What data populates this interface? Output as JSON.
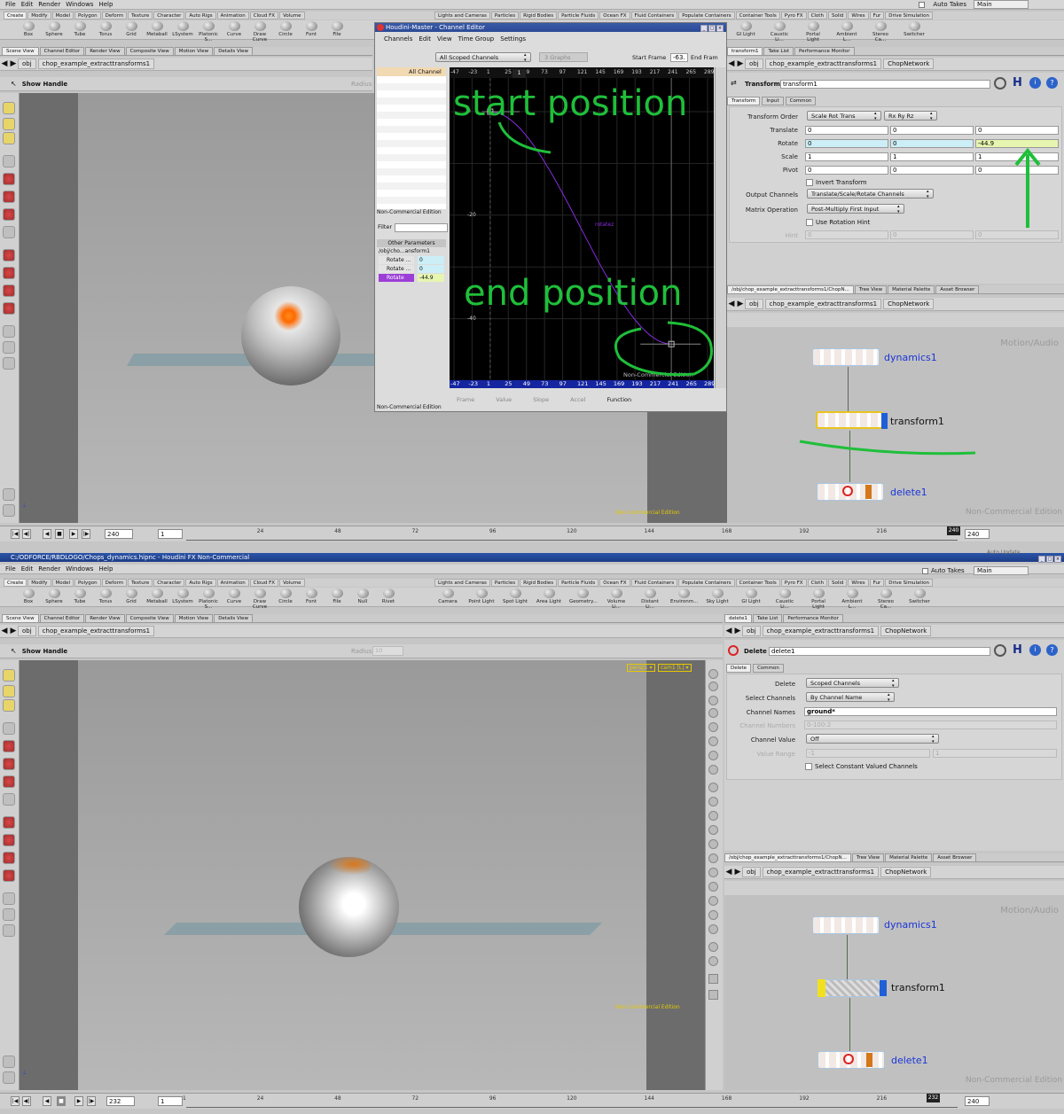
{
  "menu": [
    "File",
    "Edit",
    "Render",
    "Windows",
    "Help"
  ],
  "auto_takes": "Auto Takes",
  "takes_main": "Main",
  "shelf_tabs_left": [
    "Create",
    "Modify",
    "Model",
    "Polygon",
    "Deform",
    "Texture",
    "Character",
    "Auto Rigs",
    "Animation",
    "Cloud FX",
    "Volume"
  ],
  "shelf_tabs_right": [
    "Lights and Cameras",
    "Particles",
    "Rigid Bodies",
    "Particle Fluids",
    "Ocean FX",
    "Fluid Containers",
    "Populate Containers",
    "Container Tools",
    "Pyro FX",
    "Cloth",
    "Solid",
    "Wires",
    "Fur",
    "Drive Simulation"
  ],
  "tools_left_top": [
    "Box",
    "Sphere",
    "Tube",
    "Torus",
    "Grid",
    "Metaball",
    "LSystem",
    "Platonic S...",
    "Curve",
    "Draw Curve",
    "Circle",
    "Font",
    "File"
  ],
  "tools_left_bot": [
    "Box",
    "Sphere",
    "Tube",
    "Torus",
    "Grid",
    "Metaball",
    "LSystem",
    "Platonic S...",
    "Curve",
    "Draw Curve",
    "Circle",
    "Font",
    "File",
    "Null",
    "Rivet"
  ],
  "tools_right_top": [
    "GI Light",
    "Caustic Li...",
    "Portal Light",
    "Ambient L...",
    "Stereo Ca...",
    "Switcher"
  ],
  "tools_right_bot": [
    "Camera",
    "Point Light",
    "Spot Light",
    "Area Light",
    "Geometry...",
    "Volume Li...",
    "Distant Li...",
    "Environm...",
    "Sky Light",
    "GI Light",
    "Caustic Li...",
    "Portal Light",
    "Ambient L...",
    "Stereo Ca...",
    "Switcher"
  ],
  "pane_tabs_left": [
    "Scene View",
    "Channel Editor",
    "Render View",
    "Composite View",
    "Motion View",
    "Details View"
  ],
  "path": {
    "obj": "obj",
    "node": "chop_example_extracttransforms1",
    "net": "ChopNetwork"
  },
  "viewport": {
    "show_handle": "Show Handle",
    "radius": "Radius",
    "radius_val": "10",
    "persp": "persp1 ▾",
    "cam": "cam1 [L] ▾",
    "nce": "Non-Commercial Edition"
  },
  "channel_editor": {
    "title": "Houdini-Master - Channel Editor",
    "menu": [
      "Channels",
      "Edit",
      "View",
      "Time Group",
      "Settings"
    ],
    "scoped": "All Scoped Channels",
    "graphs": "3 Graphs",
    "start_frame_label": "Start Frame",
    "start_frame": "-63.",
    "end_frame_label": "End Fram",
    "tree_item": "All Channel",
    "nce": "Non-Commercial Edition",
    "filter": "Filter",
    "other_params": "Other Parameters",
    "param_path": "/obj/cho...ansform1",
    "params": [
      {
        "name": "Rotate ...",
        "val": "0"
      },
      {
        "name": "Rotate ...",
        "val": "0"
      },
      {
        "name": "Rotate",
        "val": "-44.9"
      }
    ],
    "top_ticks": [
      "-47",
      "-23",
      "1",
      "25",
      "49",
      "73",
      "97",
      "121",
      "145",
      "169",
      "193",
      "217",
      "241",
      "265",
      "289"
    ],
    "bottom_ticks": [
      "-47",
      "-23",
      "1",
      "25",
      "49",
      "73",
      "97",
      "121",
      "145",
      "169",
      "193",
      "217",
      "241",
      "265",
      "289"
    ],
    "y_labels": [
      "0",
      "-20",
      "-40"
    ],
    "curve_label": "rotatez",
    "cur_frame": "1",
    "bottom_fields": [
      "Frame",
      "Value",
      "Slope",
      "Accel",
      "Function"
    ]
  },
  "annotations": {
    "start": "start position",
    "end": "end position"
  },
  "transform_params": {
    "tabs": [
      "Transform",
      "Input",
      "Common"
    ],
    "op_type": "Transform",
    "op_name": "transform1",
    "pane_tabs": [
      "transform1",
      "Take List",
      "Performance Monitor"
    ],
    "transform_order_label": "Transform Order",
    "transform_order": "Scale Rot Trans",
    "rot_order": "Rx Ry Rz",
    "translate_label": "Translate",
    "translate": [
      "0",
      "0",
      "0"
    ],
    "rotate_label": "Rotate",
    "rotate": [
      "0",
      "0",
      "-44.9"
    ],
    "scale_label": "Scale",
    "scale": [
      "1",
      "1",
      "1"
    ],
    "pivot_label": "Pivot",
    "pivot": [
      "0",
      "0",
      "0"
    ],
    "invert": "Invert Transform",
    "output_channels_label": "Output Channels",
    "output_channels": "Translate/Scale/Rotate Channels",
    "matrix_op_label": "Matrix Operation",
    "matrix_op": "Post-Multiply First Input",
    "use_hint": "Use Rotation Hint",
    "hint_label": "Hint",
    "hint": [
      "0",
      "0",
      "0"
    ]
  },
  "delete_params": {
    "tabs": [
      "Delete",
      "Common"
    ],
    "op_type": "Delete",
    "op_name": "delete1",
    "pane_tabs": [
      "delete1",
      "Take List",
      "Performance Monitor"
    ],
    "delete_label": "Delete",
    "delete": "Scoped Channels",
    "select_label": "Select Channels",
    "select": "By Channel Name",
    "names_label": "Channel Names",
    "names": "ground*",
    "numbers_label": "Channel Numbers",
    "numbers": "0-100:2",
    "value_label": "Channel Value",
    "value": "Off",
    "range_label": "Value Range",
    "range": [
      "-1",
      "1"
    ],
    "select_const": "Select Constant Valued Channels"
  },
  "network": {
    "tabs": [
      "/obj/chop_example_extracttransforms1/ChopN...",
      "Tree View",
      "Material Palette",
      "Asset Browser"
    ],
    "motion_audio": "Motion/Audio",
    "nce": "Non-Commercial Edition",
    "nodes": [
      "dynamics1",
      "transform1",
      "delete1"
    ]
  },
  "timeline_top": {
    "frame": "240",
    "step": "1",
    "end": "240",
    "current": "240",
    "ticks": [
      "24",
      "48",
      "72",
      "96",
      "120",
      "144",
      "168",
      "192",
      "216"
    ]
  },
  "timeline_bot": {
    "frame": "232",
    "step": "1",
    "end": "240",
    "current": "232",
    "ticks": [
      "1",
      "24",
      "48",
      "72",
      "96",
      "120",
      "144",
      "168",
      "192",
      "216"
    ]
  },
  "window_title": "C:/ODFORCE/RBDLOGO/Chops_dynamics.hipnc - Houdini FX Non-Commercial",
  "auto_update": "Auto Update",
  "colors": {
    "annotation": "#1fbf3a",
    "curve": "#8a2be2",
    "node_blue": "#1a35d8",
    "bluebar": "#1525a0"
  }
}
